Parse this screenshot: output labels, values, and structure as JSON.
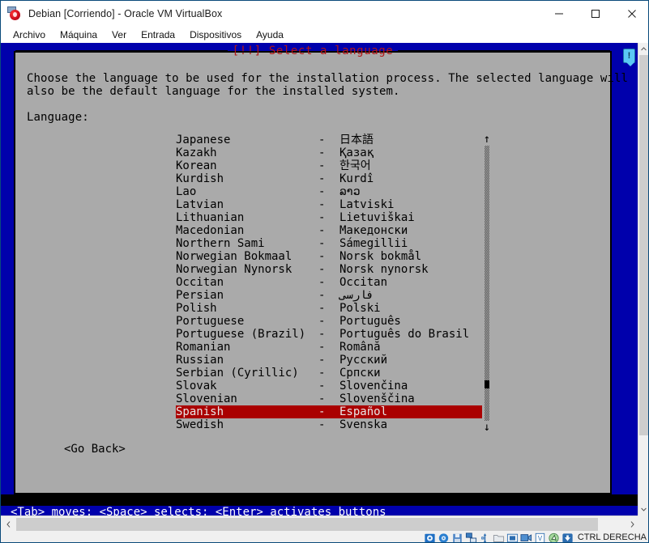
{
  "window": {
    "title": "Debian [Corriendo] - Oracle VM VirtualBox",
    "icon": "virtualbox-icon",
    "controls": {
      "minimize": "minimize-button",
      "maximize": "maximize-button",
      "close": "close-button"
    }
  },
  "menubar": {
    "items": [
      {
        "label": "Archivo"
      },
      {
        "label": "Máquina"
      },
      {
        "label": "Ver"
      },
      {
        "label": "Entrada"
      },
      {
        "label": "Dispositivos"
      },
      {
        "label": "Ayuda"
      }
    ]
  },
  "installer": {
    "dialog_title": "[!!] Select a language",
    "intro_line1": "Choose the language to be used for the installation process. The selected language will",
    "intro_line2": "also be the default language for the installed system.",
    "field_label": "Language:",
    "go_back": "<Go Back>",
    "help_line": "<Tab> moves; <Space> selects; <Enter> activates buttons",
    "selected_language": "Spanish",
    "languages": [
      {
        "english": "Japanese",
        "dash": "-",
        "native": "日本語",
        "selected": false,
        "rtl": false
      },
      {
        "english": "Kazakh",
        "dash": "-",
        "native": "Қазақ",
        "selected": false,
        "rtl": false
      },
      {
        "english": "Korean",
        "dash": "-",
        "native": "한국어",
        "selected": false,
        "rtl": false
      },
      {
        "english": "Kurdish",
        "dash": "-",
        "native": "Kurdî",
        "selected": false,
        "rtl": false
      },
      {
        "english": "Lao",
        "dash": "-",
        "native": "ລາວ",
        "selected": false,
        "rtl": false
      },
      {
        "english": "Latvian",
        "dash": "-",
        "native": "Latviski",
        "selected": false,
        "rtl": false
      },
      {
        "english": "Lithuanian",
        "dash": "-",
        "native": "Lietuviškai",
        "selected": false,
        "rtl": false
      },
      {
        "english": "Macedonian",
        "dash": "-",
        "native": "Македонски",
        "selected": false,
        "rtl": false
      },
      {
        "english": "Northern Sami",
        "dash": "-",
        "native": "Sámegillii",
        "selected": false,
        "rtl": false
      },
      {
        "english": "Norwegian Bokmaal",
        "dash": "-",
        "native": "Norsk bokmål",
        "selected": false,
        "rtl": false
      },
      {
        "english": "Norwegian Nynorsk",
        "dash": "-",
        "native": "Norsk nynorsk",
        "selected": false,
        "rtl": false
      },
      {
        "english": "Occitan",
        "dash": "-",
        "native": "Occitan",
        "selected": false,
        "rtl": false
      },
      {
        "english": "Persian",
        "dash": "-",
        "native": "فارسی",
        "selected": false,
        "rtl": true
      },
      {
        "english": "Polish",
        "dash": "-",
        "native": "Polski",
        "selected": false,
        "rtl": false
      },
      {
        "english": "Portuguese",
        "dash": "-",
        "native": "Português",
        "selected": false,
        "rtl": false
      },
      {
        "english": "Portuguese (Brazil)",
        "dash": "-",
        "native": "Português do Brasil",
        "selected": false,
        "rtl": false
      },
      {
        "english": "Romanian",
        "dash": "-",
        "native": "Română",
        "selected": false,
        "rtl": false
      },
      {
        "english": "Russian",
        "dash": "-",
        "native": "Русский",
        "selected": false,
        "rtl": false
      },
      {
        "english": "Serbian (Cyrillic)",
        "dash": "-",
        "native": "Српски",
        "selected": false,
        "rtl": false
      },
      {
        "english": "Slovak",
        "dash": "-",
        "native": "Slovenčina",
        "selected": false,
        "rtl": false
      },
      {
        "english": "Slovenian",
        "dash": "-",
        "native": "Slovenščina",
        "selected": false,
        "rtl": false
      },
      {
        "english": "Spanish",
        "dash": "-",
        "native": "Español",
        "selected": true,
        "rtl": false
      },
      {
        "english": "Swedish",
        "dash": "-",
        "native": "Svenska",
        "selected": false,
        "rtl": false
      }
    ],
    "scroll": {
      "up_arrow": "↑",
      "down_arrow": "↓"
    }
  },
  "statusbar": {
    "host_key": "CTRL DERECHA",
    "icons": [
      {
        "name": "hard-disk-icon"
      },
      {
        "name": "optical-disk-icon"
      },
      {
        "name": "floppy-disk-icon"
      },
      {
        "name": "network-icon"
      },
      {
        "name": "usb-icon"
      },
      {
        "name": "shared-folders-icon"
      },
      {
        "name": "display-icon"
      },
      {
        "name": "recording-icon"
      },
      {
        "name": "virtualization-icon"
      },
      {
        "name": "mouse-integration-icon"
      },
      {
        "name": "host-key-icon"
      }
    ]
  },
  "colors": {
    "console_blue": "#0000ac",
    "dialog_grey": "#aaaaaa",
    "title_red": "#b21515",
    "highlight_red": "#aa0000",
    "window_chrome": "#ffffff"
  }
}
